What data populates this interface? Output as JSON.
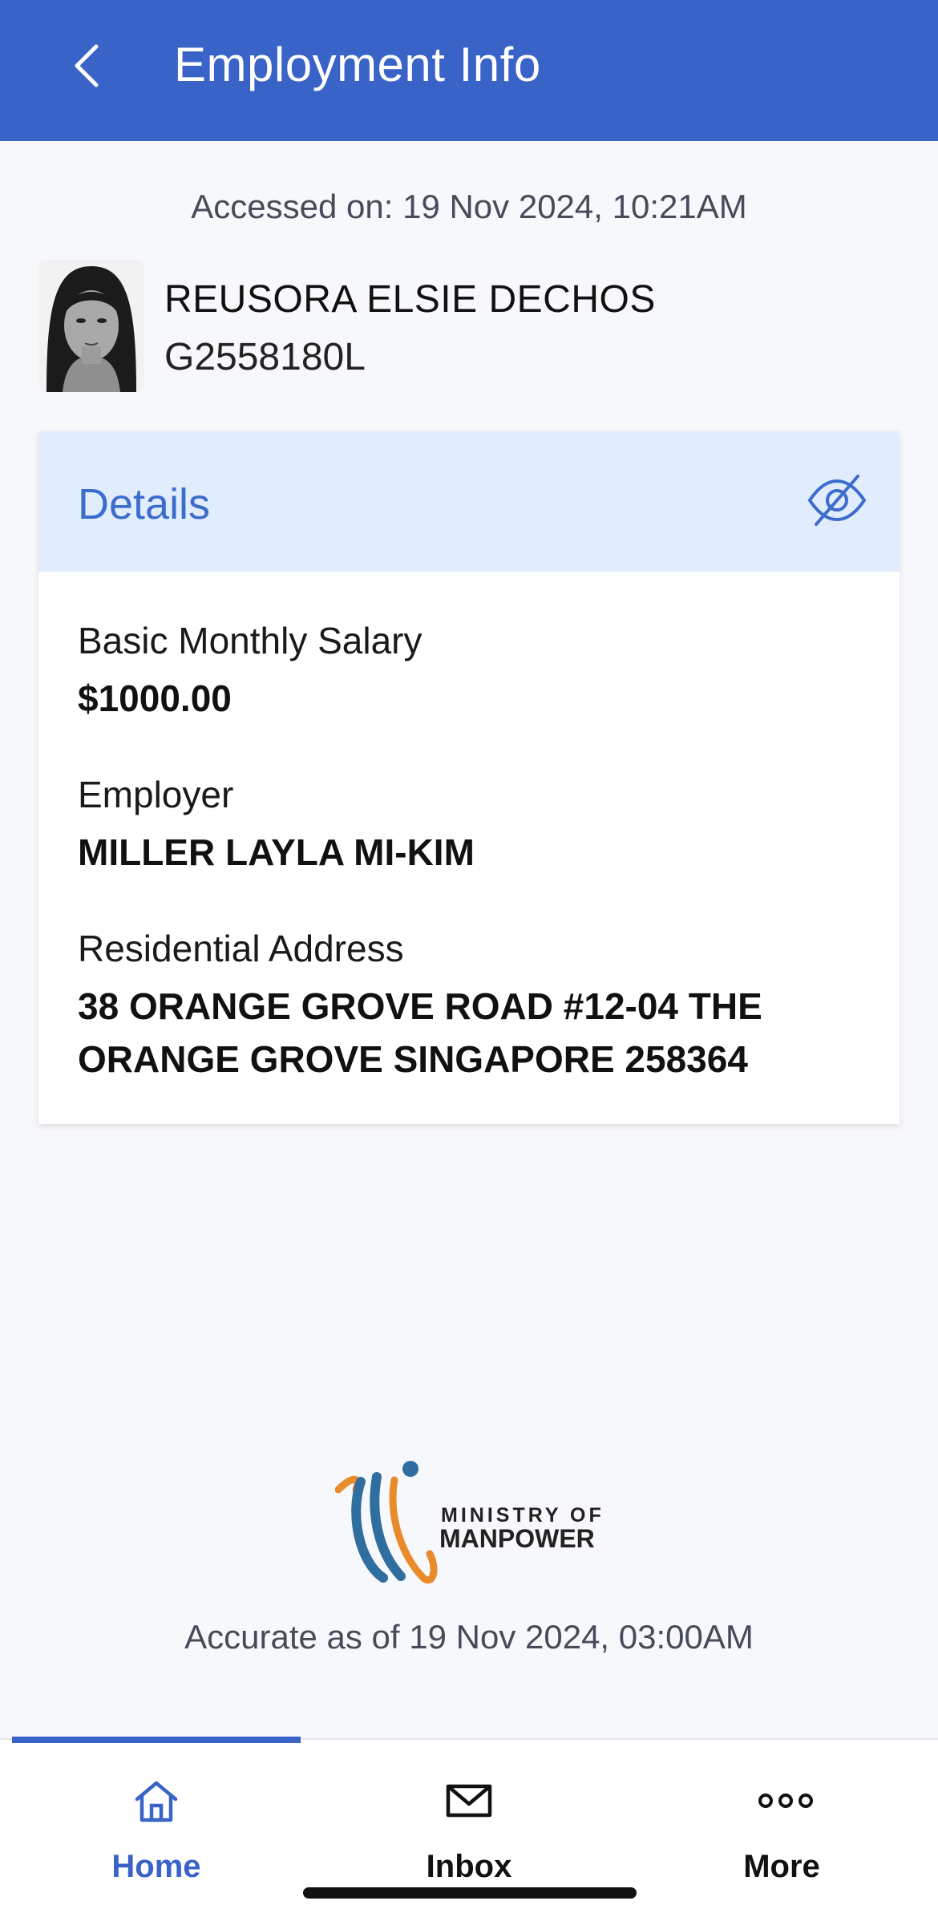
{
  "header": {
    "title": "Employment Info"
  },
  "accessed_text": "Accessed on: 19 Nov 2024, 10:21AM",
  "profile": {
    "name": "REUSORA ELSIE DECHOS",
    "id": "G2558180L"
  },
  "details": {
    "header": "Details",
    "fields": [
      {
        "label": "Basic Monthly Salary",
        "value": "$1000.00"
      },
      {
        "label": "Employer",
        "value": "MILLER LAYLA MI-KIM"
      },
      {
        "label": "Residential Address",
        "value": "38 ORANGE GROVE ROAD #12-04 THE ORANGE GROVE SINGAPORE 258364"
      }
    ]
  },
  "logo": {
    "line1": "MINISTRY OF",
    "line2": "MANPOWER"
  },
  "accurate_text": "Accurate as of 19 Nov 2024, 03:00AM",
  "nav": {
    "home": "Home",
    "inbox": "Inbox",
    "more": "More"
  },
  "colors": {
    "primary": "#3a63c7",
    "header_bg": "#e1edfd",
    "logo_orange": "#e98a2b",
    "logo_blue": "#2f6e9e"
  },
  "icons": {
    "back": "chevron-left-icon",
    "eye": "eye-off-icon",
    "home": "home-icon",
    "inbox": "mail-icon",
    "more": "more-dots-icon"
  }
}
